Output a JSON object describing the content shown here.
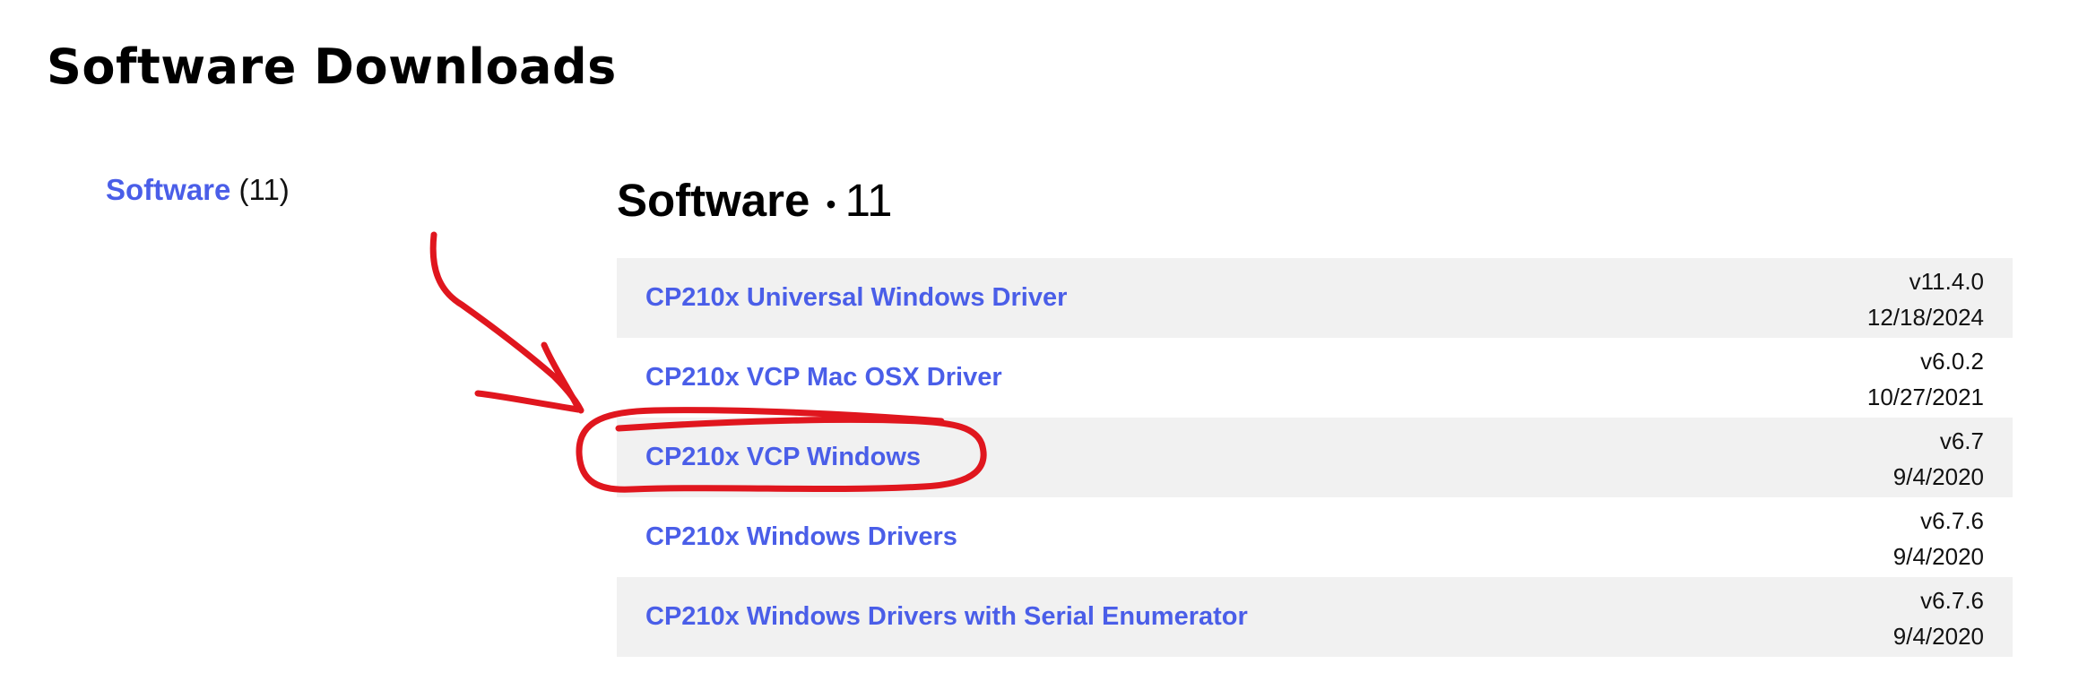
{
  "page": {
    "title": "Software Downloads"
  },
  "sidebar": {
    "items": [
      {
        "label": "Software",
        "count": "(11)"
      }
    ]
  },
  "section": {
    "name": "Software",
    "separator": "•",
    "count": "11"
  },
  "downloads": [
    {
      "name": "CP210x Universal Windows Driver",
      "version": "v11.4.0",
      "date": "12/18/2024"
    },
    {
      "name": "CP210x VCP Mac OSX Driver",
      "version": "v6.0.2",
      "date": "10/27/2021"
    },
    {
      "name": "CP210x VCP Windows",
      "version": "v6.7",
      "date": "9/4/2020"
    },
    {
      "name": "CP210x Windows Drivers",
      "version": "v6.7.6",
      "date": "9/4/2020"
    },
    {
      "name": "CP210x Windows Drivers with Serial Enumerator",
      "version": "v6.7.6",
      "date": "9/4/2020"
    }
  ],
  "colors": {
    "link": "#4a5ee8",
    "row_shade": "#f1f1f1",
    "annotation": "#e0161e"
  }
}
